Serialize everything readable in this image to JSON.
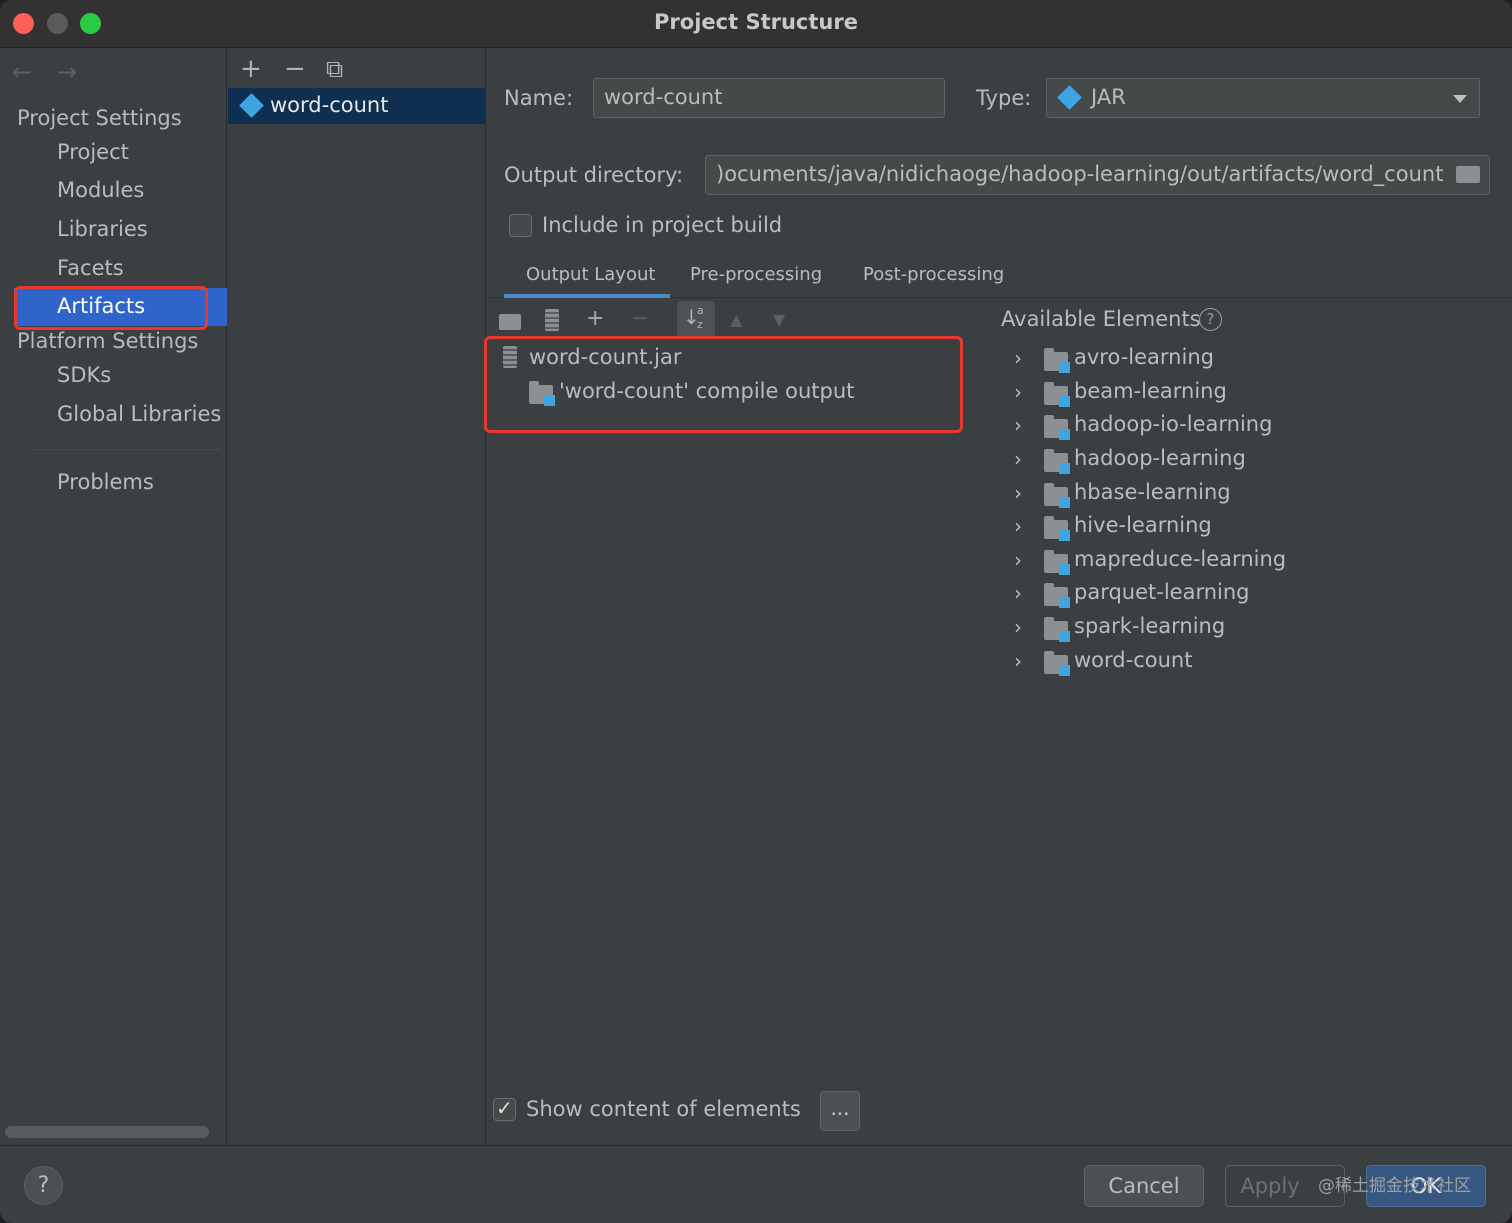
{
  "window": {
    "title": "Project Structure"
  },
  "nav": {
    "back_icon": "←",
    "forward_icon": "→",
    "project_settings_header": "Project Settings",
    "project_items": [
      "Project",
      "Modules",
      "Libraries",
      "Facets"
    ],
    "selected_item": "Artifacts",
    "platform_settings_header": "Platform Settings",
    "platform_items": [
      "SDKs",
      "Global Libraries"
    ],
    "problems": "Problems"
  },
  "artifact_list": {
    "add_icon": "+",
    "remove_icon": "−",
    "copy_icon": "⧉",
    "items": [
      "word-count"
    ]
  },
  "details": {
    "name_label": "Name:",
    "name_value": "word-count",
    "type_label": "Type:",
    "type_value": "JAR",
    "output_dir_label": "Output directory:",
    "output_dir_value": ")ocuments/java/nidichaoge/hadoop-learning/out/artifacts/word_count",
    "include_build_label": "Include in project build",
    "include_build_checked": false,
    "tabs": [
      "Output Layout",
      "Pre-processing",
      "Post-processing"
    ],
    "active_tab": "Output Layout"
  },
  "layout_tree": {
    "root": "word-count.jar",
    "children": [
      "'word-count' compile output"
    ]
  },
  "available": {
    "header": "Available Elements",
    "help_icon": "?",
    "items": [
      "avro-learning",
      "beam-learning",
      "hadoop-io-learning",
      "hadoop-learning",
      "hbase-learning",
      "hive-learning",
      "mapreduce-learning",
      "parquet-learning",
      "spark-learning",
      "word-count"
    ]
  },
  "show_content": {
    "label": "Show content of elements",
    "checked": true,
    "more_button": "..."
  },
  "footer": {
    "help": "?",
    "cancel": "Cancel",
    "apply": "Apply",
    "ok": "OK",
    "watermark": "@稀土掘金技术社区"
  },
  "colors": {
    "selection": "#2f65ca",
    "highlight": "#e53b2e",
    "module_accent": "#3fa5e0"
  }
}
